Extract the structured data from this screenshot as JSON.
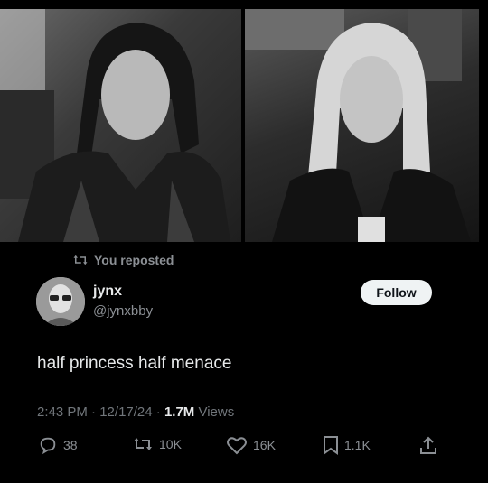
{
  "repost": {
    "label": "You reposted",
    "icon": "repost-icon"
  },
  "author": {
    "name": "jynx",
    "handle": "@jynxbby",
    "avatar": "avatar"
  },
  "follow_button": {
    "label": "Follow"
  },
  "tweet": {
    "text": "half princess half menace"
  },
  "meta": {
    "time": "2:43 PM",
    "sep1": " · ",
    "date": "12/17/24",
    "sep2": " · ",
    "views_count": "1.7M",
    "views_label": " Views"
  },
  "actions": {
    "replies": {
      "count": "38",
      "icon": "reply-icon"
    },
    "reposts": {
      "count": "10K",
      "icon": "repost-icon"
    },
    "likes": {
      "count": "16K",
      "icon": "heart-icon"
    },
    "bookmarks": {
      "count": "1.1K",
      "icon": "bookmark-icon"
    },
    "share": {
      "icon": "share-icon"
    }
  },
  "colors": {
    "background": "#000000",
    "text": "#e7e9ea",
    "muted": "#71767b",
    "follow_bg": "#eff3f4"
  }
}
